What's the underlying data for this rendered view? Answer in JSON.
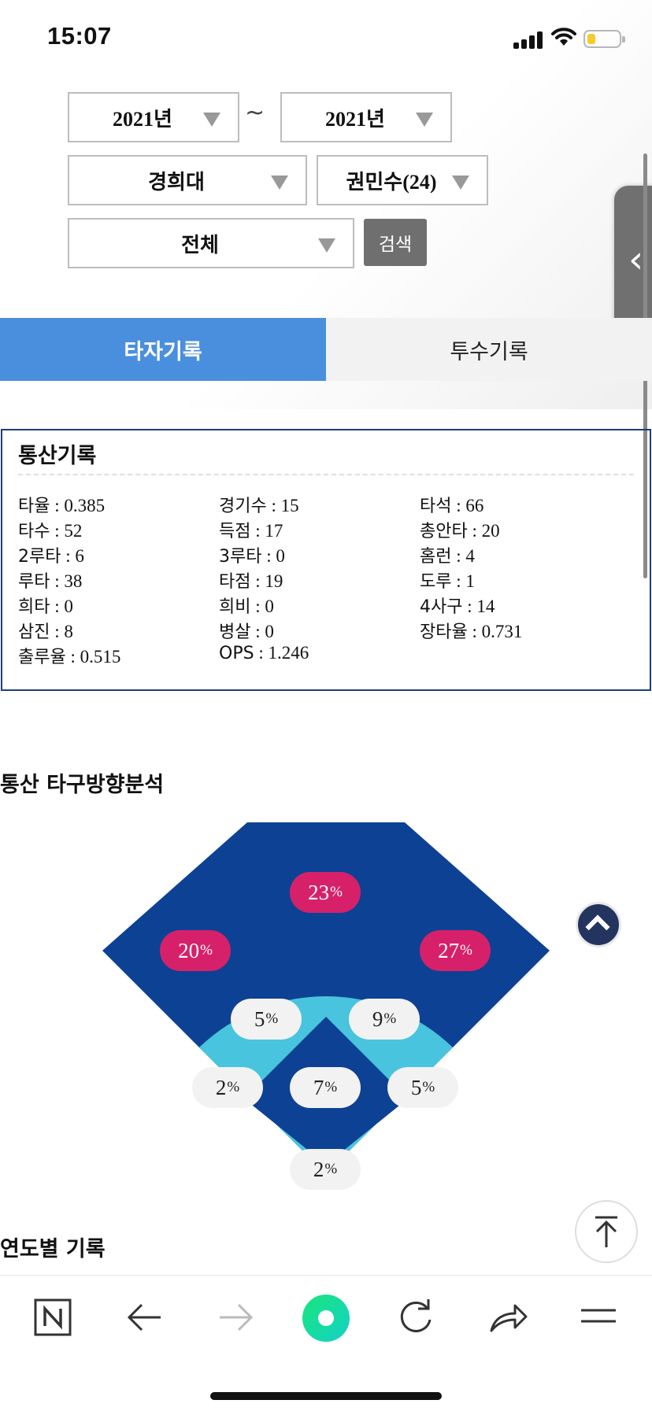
{
  "status_bar": {
    "time": "15:07"
  },
  "filters": {
    "year_from": "2021년",
    "tilde": "~",
    "year_to": "2021년",
    "team": "경희대",
    "player": "권민수(24)",
    "scope": "전체",
    "search_label": "검색"
  },
  "tabs": [
    {
      "label": "타자기록",
      "active": true
    },
    {
      "label": "투수기록",
      "active": false
    }
  ],
  "career": {
    "title": "통산기록",
    "stats": [
      [
        {
          "label": "타율",
          "value": "0.385"
        },
        {
          "label": "경기수",
          "value": "15"
        },
        {
          "label": "타석",
          "value": "66"
        }
      ],
      [
        {
          "label": "타수",
          "value": "52"
        },
        {
          "label": "득점",
          "value": "17"
        },
        {
          "label": "총안타",
          "value": "20"
        }
      ],
      [
        {
          "label": "2루타",
          "value": "6"
        },
        {
          "label": "3루타",
          "value": "0"
        },
        {
          "label": "홈런",
          "value": "4"
        }
      ],
      [
        {
          "label": "루타",
          "value": "38"
        },
        {
          "label": "타점",
          "value": "19"
        },
        {
          "label": "도루",
          "value": "1"
        }
      ],
      [
        {
          "label": "희타",
          "value": "0"
        },
        {
          "label": "희비",
          "value": "0"
        },
        {
          "label": "4사구",
          "value": "14"
        }
      ],
      [
        {
          "label": "삼진",
          "value": "8"
        },
        {
          "label": "병살",
          "value": "0"
        },
        {
          "label": "장타율",
          "value": "0.731"
        }
      ],
      [
        {
          "label": "출루율",
          "value": "0.515"
        },
        {
          "label": "OPS",
          "value": "1.246"
        }
      ]
    ]
  },
  "direction": {
    "title": "통산 타구방향분석",
    "zones": [
      {
        "zone": "center-deep",
        "value": "23",
        "unit": "%",
        "color": "#d6216a"
      },
      {
        "zone": "left-deep",
        "value": "20",
        "unit": "%",
        "color": "#d6216a"
      },
      {
        "zone": "right-deep",
        "value": "27",
        "unit": "%",
        "color": "#d6216a"
      },
      {
        "zone": "left-mid",
        "value": "5",
        "unit": "%",
        "color": "#f2f2f2"
      },
      {
        "zone": "right-mid",
        "value": "9",
        "unit": "%",
        "color": "#f2f2f2"
      },
      {
        "zone": "left-line",
        "value": "2",
        "unit": "%",
        "color": "#f2f2f2"
      },
      {
        "zone": "infield",
        "value": "7",
        "unit": "%",
        "color": "#f2f2f2"
      },
      {
        "zone": "right-line",
        "value": "5",
        "unit": "%",
        "color": "#f2f2f2"
      },
      {
        "zone": "home",
        "value": "2",
        "unit": "%",
        "color": "#f2f2f2"
      }
    ],
    "colors": {
      "outfield": "#0d4193",
      "infield_arc": "#48c4de",
      "infield_diamond": "#0d4193"
    }
  },
  "yearly": {
    "title": "연도별 기록"
  },
  "bottom_nav": {
    "items": [
      "naver-icon",
      "back-arrow-icon",
      "forward-arrow-icon",
      "green-dot-icon",
      "refresh-icon",
      "share-icon",
      "menu-icon"
    ]
  }
}
